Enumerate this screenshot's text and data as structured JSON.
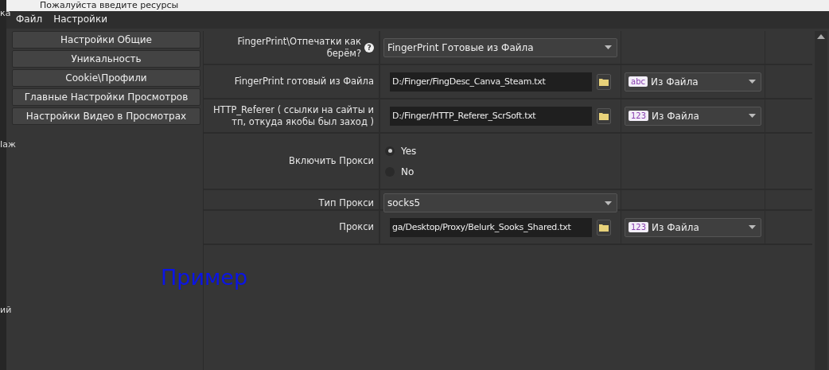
{
  "background_fragments": [
    "ка",
    "Іаж",
    "ий"
  ],
  "window": {
    "title": "Пожалуйста введите ресурсы"
  },
  "menu": [
    "Файл",
    "Настройки"
  ],
  "sidebar": {
    "items": [
      {
        "label": "Настройки Общие"
      },
      {
        "label": "Уникальность"
      },
      {
        "label": "Cookie\\Профили"
      },
      {
        "label": "Главные Настройки Просмотров"
      },
      {
        "label": "Настройки Видео в Просмотрах"
      }
    ]
  },
  "form": {
    "rows": [
      {
        "kind": "combo",
        "label": "FingerPrint\\Отпечатки как берём?",
        "help": "?",
        "value": "FingerPrint Готовые из Файла"
      },
      {
        "kind": "file",
        "label": "FingerPrint готовый из Файла",
        "path": "D:/Finger/FingDesc_Canva_Steam.txt",
        "source": {
          "badge": "abc",
          "value": "Из Файла"
        }
      },
      {
        "kind": "file",
        "label": "HTTP_Referer ( ссылки на сайты и тп, откуда якобы был заход )",
        "path": "D:/Finger/HTTP_Referer_ScrSoft.txt",
        "source": {
          "badge": "123",
          "value": "Из Файла"
        }
      },
      {
        "kind": "radio",
        "label": "Включить Прокси",
        "options": [
          {
            "label": "Yes",
            "selected": true
          },
          {
            "label": "No",
            "selected": false
          }
        ]
      },
      {
        "kind": "combo",
        "label": "Тип Прокси",
        "value": "socks5"
      },
      {
        "kind": "file",
        "label": "Прокси",
        "path": "ga/Desktop/Proxy/Belurk_Sooks_Shared.txt",
        "source": {
          "badge": "123",
          "value": "Из Файла"
        }
      }
    ]
  },
  "overlay_text": "Пример"
}
